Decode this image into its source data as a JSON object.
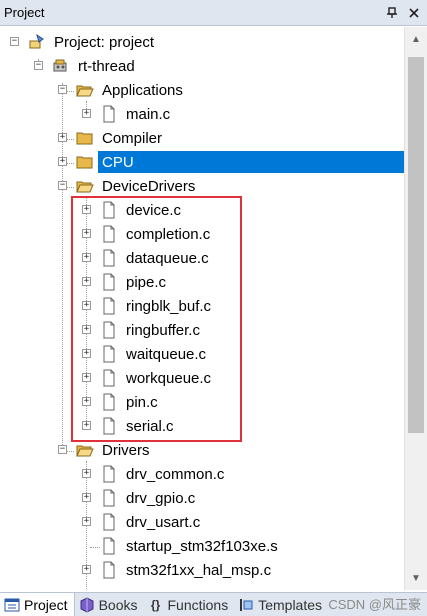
{
  "window": {
    "title": "Project"
  },
  "tree": {
    "root": "Project: project",
    "group": "rt-thread",
    "applications": {
      "label": "Applications",
      "files": [
        "main.c"
      ]
    },
    "compiler": "Compiler",
    "cpu": "CPU",
    "devicedrivers": {
      "label": "DeviceDrivers",
      "files": [
        "device.c",
        "completion.c",
        "dataqueue.c",
        "pipe.c",
        "ringblk_buf.c",
        "ringbuffer.c",
        "waitqueue.c",
        "workqueue.c",
        "pin.c",
        "serial.c"
      ]
    },
    "drivers": {
      "label": "Drivers",
      "files": [
        "drv_common.c",
        "drv_gpio.c",
        "drv_usart.c",
        "startup_stm32f103xe.s",
        "stm32f1xx_hal_msp.c"
      ]
    }
  },
  "tabs": [
    {
      "label": "Project",
      "icon": "project-icon"
    },
    {
      "label": "Books",
      "icon": "books-icon"
    },
    {
      "label": "Functions",
      "icon": "functions-icon"
    },
    {
      "label": "Templates",
      "icon": "templates-icon"
    }
  ],
  "watermark": "CSDN @风正豪",
  "colors": {
    "selection": "#0078d7",
    "highlight_box": "#e0303c",
    "folder": "#e8b84a"
  }
}
